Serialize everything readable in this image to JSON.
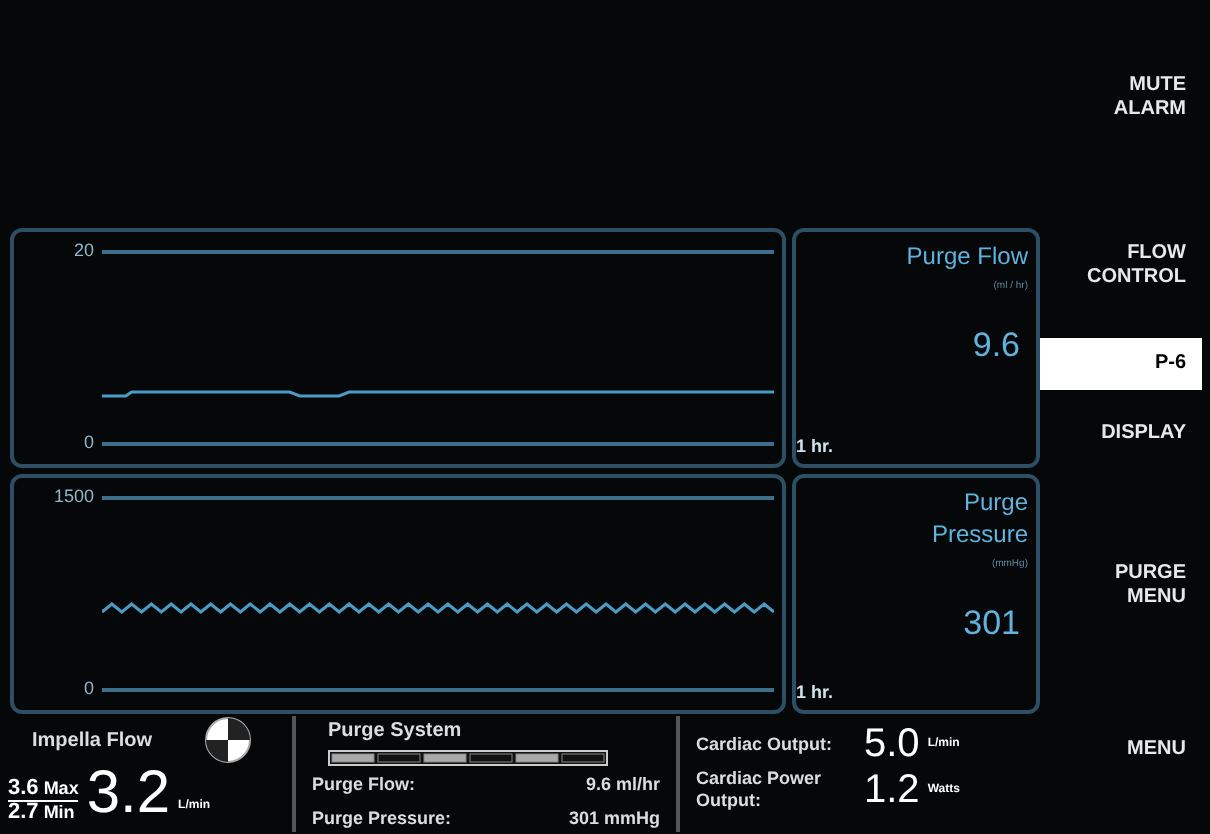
{
  "trends": [
    {
      "y_max": "20",
      "y_min": "0",
      "title": "Purge Flow",
      "unit": "(ml / hr)",
      "value": "9.6",
      "timespan": "1 hr.",
      "kind": "flat"
    },
    {
      "y_max": "1500",
      "y_min": "0",
      "title": "Purge Pressure",
      "unit": "(mmHg)",
      "value": "301",
      "timespan": "1 hr.",
      "kind": "wavy"
    }
  ],
  "impella_flow": {
    "title": "Impella Flow",
    "max_value": "3.6",
    "max_label": "Max",
    "min_value": "2.7",
    "min_label": "Min",
    "value": "3.2",
    "unit": "L/min"
  },
  "purge_system": {
    "title": "Purge System",
    "rows": [
      {
        "label": "Purge Flow:",
        "value": "9.6 ml/hr"
      },
      {
        "label": "Purge Pressure:",
        "value": "301 mmHg"
      }
    ]
  },
  "cardiac": [
    {
      "label": "Cardiac Output:",
      "value": "5.0",
      "unit": "L/min"
    },
    {
      "label": "Cardiac Power Output:",
      "value": "1.2",
      "unit": "Watts"
    }
  ],
  "soft_keys": [
    {
      "label": "MUTE ALARM",
      "selected": false
    },
    {
      "label": "FLOW CONTROL",
      "selected": false
    },
    {
      "label": "P-6",
      "selected": true
    },
    {
      "label": "DISPLAY",
      "selected": false
    },
    {
      "label": "PURGE MENU",
      "selected": false
    },
    {
      "label": "MENU",
      "selected": false
    }
  ]
}
